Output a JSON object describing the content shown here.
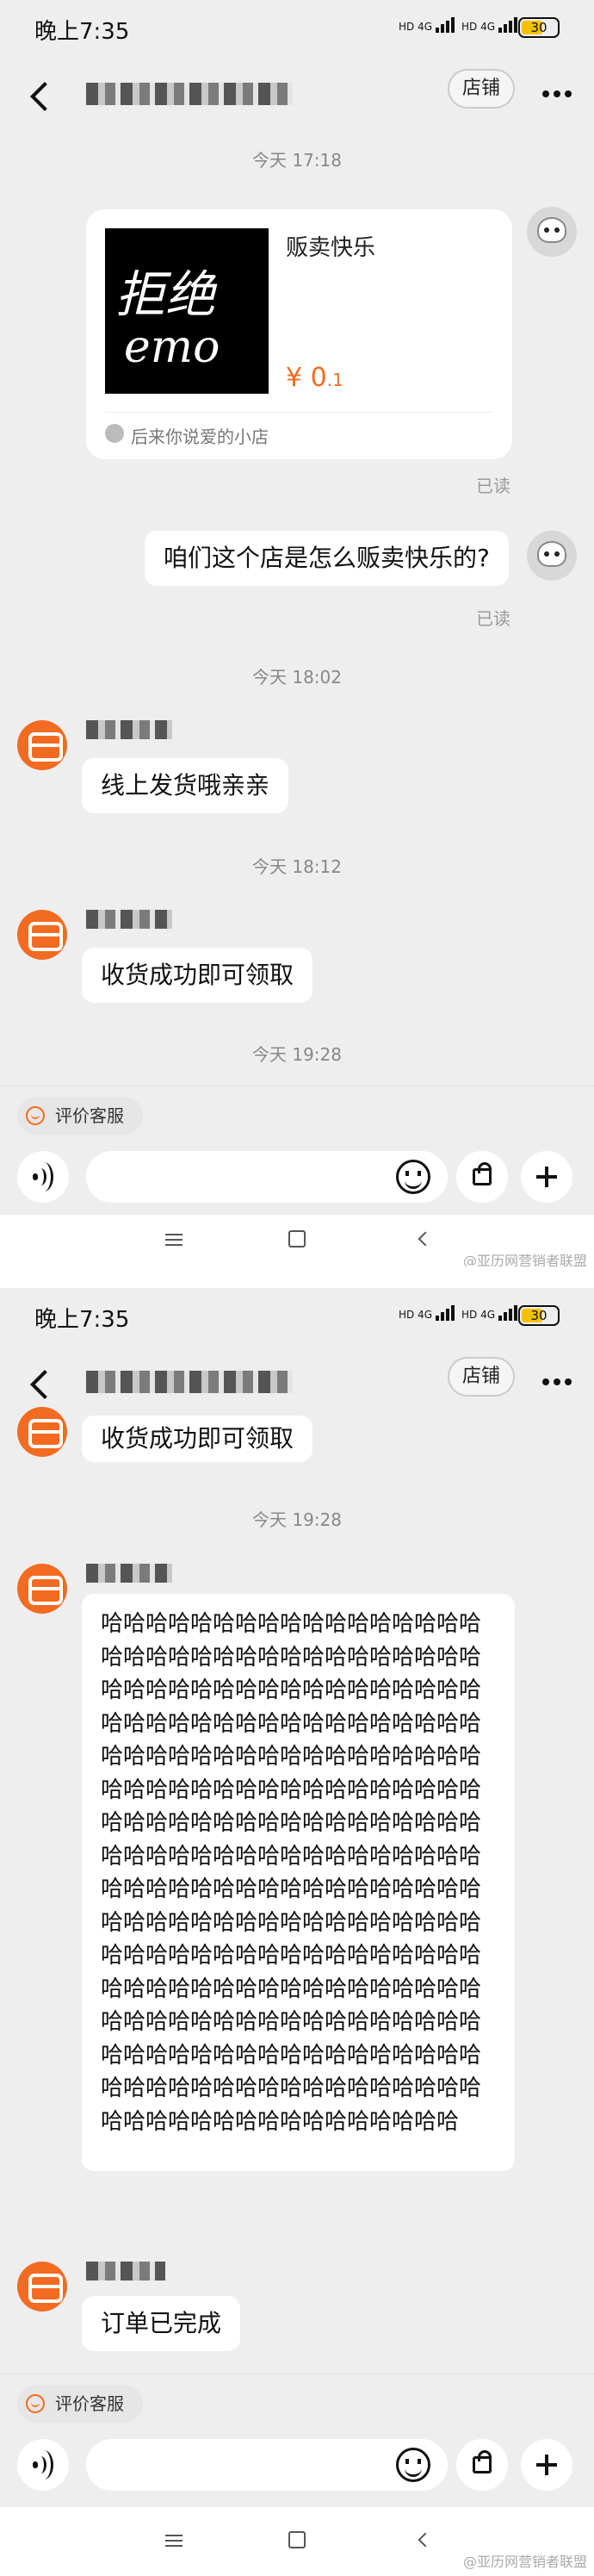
{
  "status_bar": {
    "time": "晚上7:35",
    "hd": "HD",
    "net": "4G",
    "battery": "30"
  },
  "header": {
    "shop_button": "店铺"
  },
  "panel1": {
    "ts1": "今天  17:18",
    "product_card": {
      "image_text_line1": "拒绝",
      "image_text_line2": "emo",
      "title": "贩卖快乐",
      "price_symbol": "¥",
      "price_int": "0",
      "price_dec": ".1",
      "shop_name": "后来你说爱的小店"
    },
    "read1": "已读",
    "my_question": "咱们这个店是怎么贩卖快乐的?",
    "read2": "已读",
    "ts2": "今天  18:02",
    "reply1": "线上发货哦亲亲",
    "ts3": "今天  18:12",
    "reply2": "收货成功即可领取",
    "ts4": "今天  19:28"
  },
  "panel2": {
    "reply2_partial": "收货成功即可领取",
    "ts": "今天  19:28",
    "laugh_message": "哈哈哈哈哈哈哈哈哈哈哈哈哈哈哈哈哈哈哈哈哈哈哈哈哈哈哈哈哈哈哈哈哈哈哈哈哈哈哈哈哈哈哈哈哈哈哈哈哈哈哈哈哈哈哈哈哈哈哈哈哈哈哈哈哈哈哈哈哈哈哈哈哈哈哈哈哈哈哈哈哈哈哈哈哈哈哈哈哈哈哈哈哈哈哈哈哈哈哈哈哈哈哈哈哈哈哈哈哈哈哈哈哈哈哈哈哈哈哈哈哈哈哈哈哈哈哈哈哈哈哈哈哈哈哈哈哈哈哈哈哈哈哈哈哈哈哈哈哈哈哈哈哈哈哈哈哈哈哈哈哈哈哈哈哈哈哈哈哈哈哈哈哈哈哈哈哈哈哈哈哈哈哈哈哈哈哈哈哈哈哈哈哈哈哈哈哈哈哈哈哈哈哈哈哈哈哈哈哈哈哈哈哈哈哈哈哈哈哈哈哈哈哈哈哈哈哈哈哈哈哈哈哈哈哈哈哈哈哈哈哈哈哈哈哈哈哈哈哈哈哈哈哈哈哈哈哈哈哈哈哈哈哈哈哈哈哈哈哈哈哈",
    "final_reply": "订单已完成"
  },
  "toolbar": {
    "rate_service": "评价客服"
  },
  "watermark": "@亚历网营销者联盟",
  "colors": {
    "accent": "#f26b21",
    "background": "#eeeeee",
    "bubble": "#ffffff"
  }
}
